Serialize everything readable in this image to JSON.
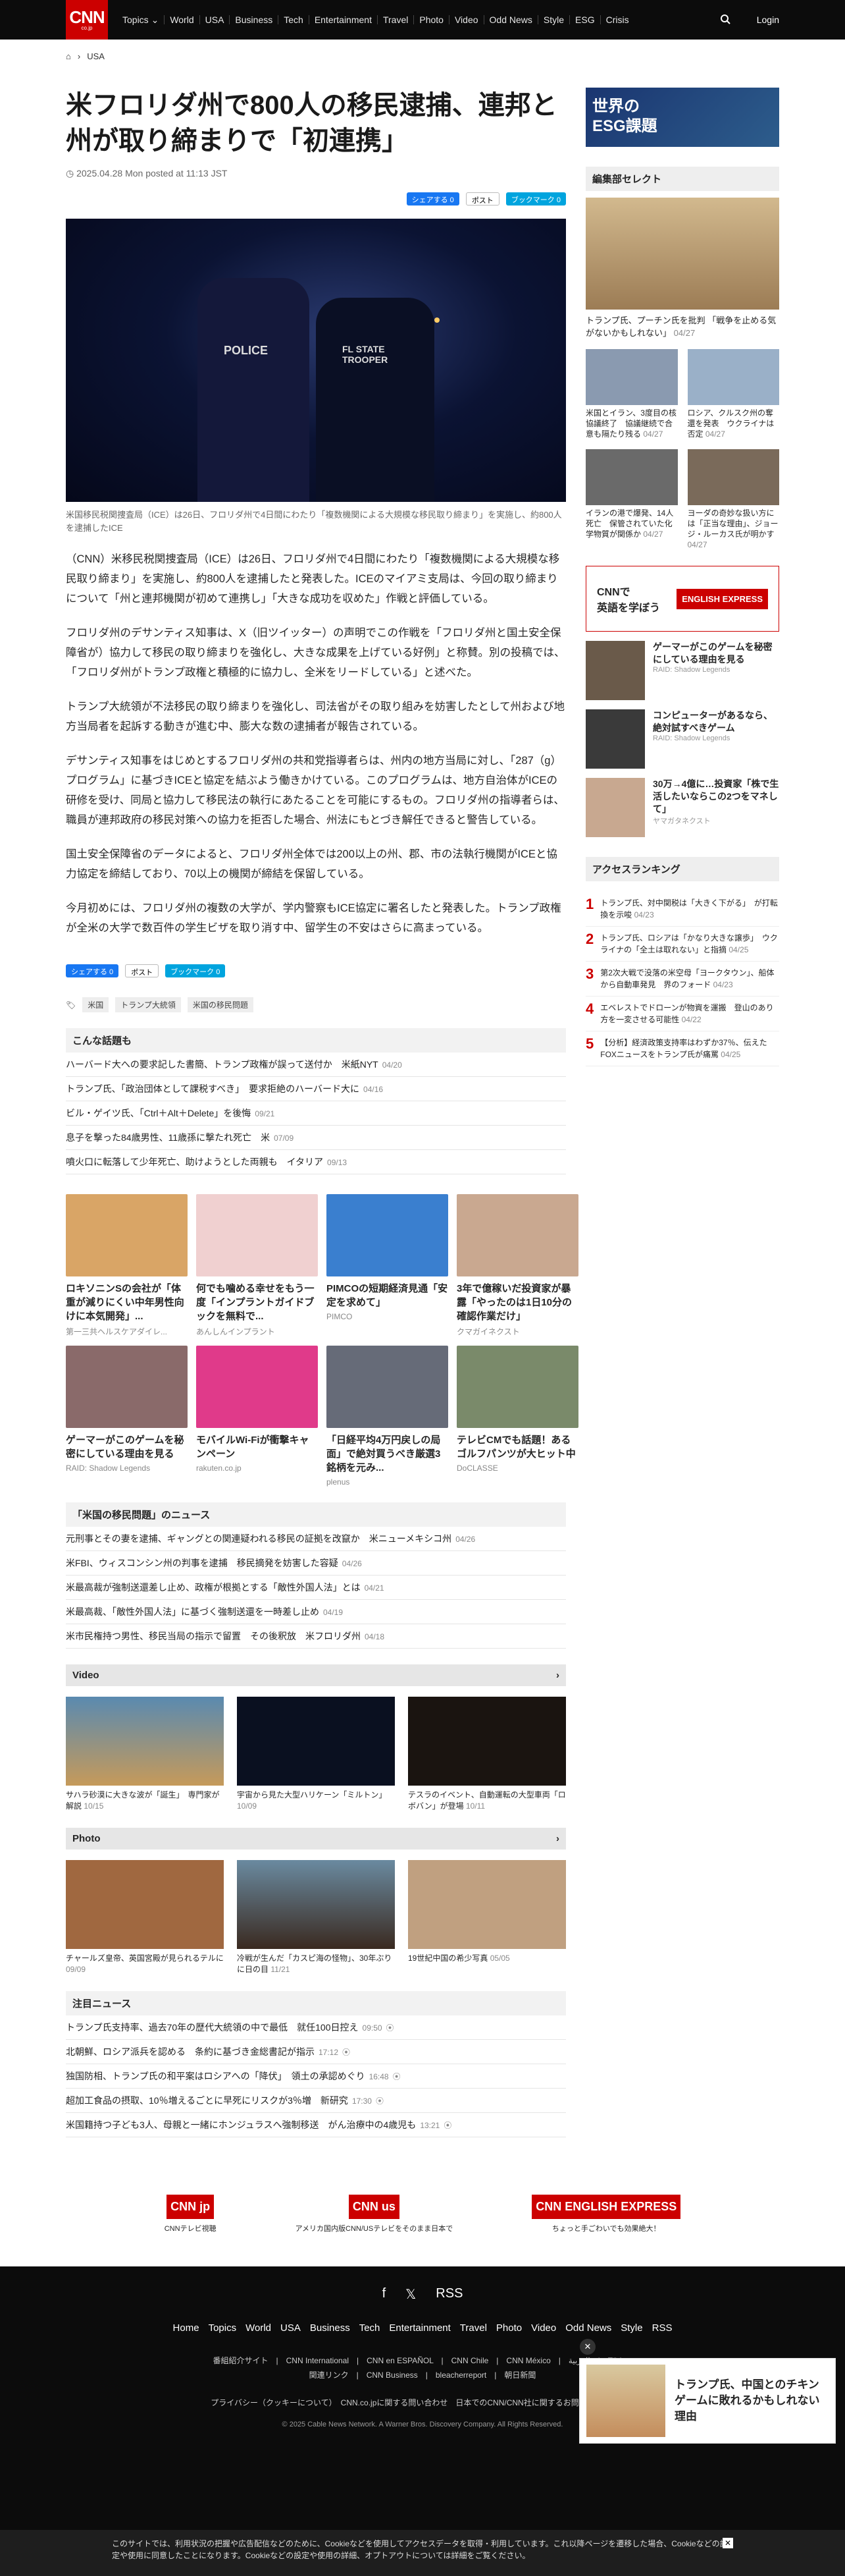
{
  "nav": {
    "logo": "CNN",
    "logo_sub": "co.jp",
    "items": [
      "Topics ⌄",
      "World",
      "USA",
      "Business",
      "Tech",
      "Entertainment",
      "Travel",
      "Photo",
      "Video",
      "Odd News",
      "Style",
      "ESG",
      "Crisis"
    ],
    "login": "Login"
  },
  "breadcrumb": {
    "home": "⌂",
    "current": "USA"
  },
  "article": {
    "title": "米フロリダ州で800人の移民逮捕、連邦と州が取り締まりで「初連携」",
    "date": "2025.04.28 Mon posted at 11:13 JST",
    "share": [
      "シェアする 0",
      "ポスト",
      "ブックマーク 0"
    ],
    "caption": "米国移民税関捜査局（ICE）は26日、フロリダ州で4日間にわたり「複数機関による大規模な移民取り締まり」を実施し、約800人を逮捕したICE",
    "paragraphs": [
      "（CNN）米移民税関捜査局（ICE）は26日、フロリダ州で4日間にわたり「複数機関による大規模な移民取り締まり」を実施し、約800人を逮捕したと発表した。ICEのマイアミ支局は、今回の取り締まりについて「州と連邦機関が初めて連携し」「大きな成功を収めた」作戦と評価している。",
      "フロリダ州のデサンティス知事は、X（旧ツイッター）の声明でこの作戦を「フロリダ州と国土安全保障省が）協力して移民の取り締まりを強化し、大きな成果を上げている好例」と称賛。別の投稿では、「フロリダ州がトランプ政権と積極的に協力し、全米をリードしている」と述べた。",
      "トランプ大統領が不法移民の取り締まりを強化し、司法省がその取り組みを妨害したとして州および地方当局者を起訴する動きが進む中、膨大な数の逮捕者が報告されている。",
      "デサンティス知事をはじめとするフロリダ州の共和党指導者らは、州内の地方当局に対し、「287（g）プログラム」に基づきICEと協定を結ぶよう働きかけている。このプログラムは、地方自治体がICEの研修を受け、同局と協力して移民法の執行にあたることを可能にするもの。フロリダ州の指導者らは、職員が連邦政府の移民対策への協力を拒否した場合、州法にもとづき解任できると警告している。",
      "国土安全保障省のデータによると、フロリダ州全体では200以上の州、郡、市の法執行機関がICEと協力協定を締結しており、70以上の機関が締結を保留している。",
      "今月初めには、フロリダ州の複数の大学が、学内警察もICE協定に署名したと発表した。トランプ政権が全米の大学で数百件の学生ビザを取り消す中、留学生の不安はさらに高まっている。"
    ],
    "tags": [
      "米国",
      "トランプ大統領",
      "米国の移民問題"
    ]
  },
  "related": {
    "title": "こんな話題も",
    "items": [
      {
        "t": "ハーバード大への要求記した書簡、トランプ政権が誤って送付か　米紙NYT",
        "d": "04/20"
      },
      {
        "t": "トランプ氏、「政治団体として課税すべき」　要求拒絶のハーバード大に",
        "d": "04/16"
      },
      {
        "t": "ビル・ゲイツ氏、「Ctrl＋Alt＋Delete」を後悔",
        "d": "09/21"
      },
      {
        "t": "息子を撃った84歳男性、11歳孫に撃たれ死亡　米",
        "d": "07/09"
      },
      {
        "t": "噴火口に転落して少年死亡、助けようとした両親も　イタリア",
        "d": "09/13"
      }
    ]
  },
  "ads": [
    {
      "t": "ロキソニンSの会社が「体重が減りにくい中年男性向けに本気開発」...",
      "s": "第一三共ヘルスケアダイレ..."
    },
    {
      "t": "何でも噛める幸せをもう一度「インプラントガイドブックを無料で...",
      "s": "あんしんインプラント"
    },
    {
      "t": "PIMCOの短期経済見通「安定を求めて」",
      "s": "PIMCO"
    },
    {
      "t": "3年で億稼いだ投資家が暴露「やったのは1日10分の確認作業だけ」",
      "s": "クマガイネクスト"
    },
    {
      "t": "ゲーマーがこのゲームを秘密にしている理由を見る",
      "s": "RAID: Shadow Legends"
    },
    {
      "t": "モバイルWi-Fiが衝撃キャンペーン",
      "s": "rakuten.co.jp"
    },
    {
      "t": "「日経平均4万円戻しの局面」で絶対買うべき厳選3銘柄を元み...",
      "s": "plenus"
    },
    {
      "t": "テレビCMでも話題！あるゴルフパンツが大ヒット中",
      "s": "DoCLASSE"
    }
  ],
  "immig": {
    "title": "「米国の移民問題」のニュース",
    "items": [
      {
        "t": "元刑事とその妻を逮捕、ギャングとの関連疑われる移民の証拠を改竄か　米ニューメキシコ州",
        "d": "04/26"
      },
      {
        "t": "米FBI、ウィスコンシン州の判事を逮捕　移民摘発を妨害した容疑",
        "d": "04/26"
      },
      {
        "t": "米最高裁が強制送還差し止め、政権が根拠とする「敵性外国人法」とは",
        "d": "04/21"
      },
      {
        "t": "米最高裁、「敵性外国人法」に基づく強制送還を一時差し止め",
        "d": "04/19"
      },
      {
        "t": "米市民権持つ男性、移民当局の指示で留置　その後釈放　米フロリダ州",
        "d": "04/18"
      }
    ]
  },
  "video": {
    "title": "Video",
    "items": [
      {
        "t": "サハラ砂漠に大きな波が「誕生」　専門家が解説",
        "d": "10/15"
      },
      {
        "t": "宇宙から見た大型ハリケーン「ミルトン」",
        "d": "10/09"
      },
      {
        "t": "テスラのイベント、自動運転の大型車両「ロボバン」が登場",
        "d": "10/11"
      }
    ]
  },
  "photo": {
    "title": "Photo",
    "items": [
      {
        "t": "チャールズ皇帝、英国宮殿が見られるテルに",
        "d": "09/09"
      },
      {
        "t": "冷戦が生んだ「カスピ海の怪物」、30年ぶりに日の目",
        "d": "11/21"
      },
      {
        "t": "19世紀中国の希少写真",
        "d": "05/05"
      }
    ]
  },
  "notice": {
    "title": "注目ニュース",
    "items": [
      {
        "t": "トランプ氏支持率、過去70年の歴代大統領の中で最低　就任100日控え",
        "d": "09:50"
      },
      {
        "t": "北朝鮮、ロシア派兵を認める　条約に基づき金総書記が指示",
        "d": "17:12"
      },
      {
        "t": "独国防相、トランプ氏の和平案はロシアへの「降伏」　領土の承認めぐり",
        "d": "16:48"
      },
      {
        "t": "超加工食品の摂取、10％増えるごとに早死にリスクが3％増　新研究",
        "d": "17:30"
      },
      {
        "t": "米国籍持つ子ども3人、母親と一緒にホンジュラスへ強制移送　がん治療中の4歳児も",
        "d": "13:21"
      }
    ]
  },
  "side": {
    "banner": "世界の\nESG課題",
    "editor": "編集部セレクト",
    "main": {
      "t": "トランプ氏、プーチン氏を批判 「戦争を止める気がないかもしれない」",
      "d": "04/27"
    },
    "small": [
      {
        "t": "米国とイラン、3度目の核協議終了　協議継続で合意も隔たり残る",
        "d": "04/27"
      },
      {
        "t": "ロシア、クルスク州の奪還を発表　ウクライナは否定",
        "d": "04/27"
      },
      {
        "t": "イランの港で爆発、14人死亡　保管されていた化学物質が関係か",
        "d": "04/27"
      },
      {
        "t": "ヨーダの奇妙な扱い方には「正当な理由」、ジョージ・ルーカス氏が明かす",
        "d": "04/27"
      }
    ],
    "english": {
      "a": "CNNで\n英語を学ぼう",
      "b": "ENGLISH EXPRESS"
    },
    "ads": [
      {
        "t": "ゲーマーがこのゲームを秘密にしている理由を見る",
        "s": "RAID: Shadow Legends"
      },
      {
        "t": "コンピューターがあるなら、絶対試すべきゲーム",
        "s": "RAID: Shadow Legends"
      },
      {
        "t": "30万→4億に…投資家「株で生活したいならこの2つをマネして」",
        "s": "ヤマガタネクスト"
      }
    ],
    "rank_title": "アクセスランキング",
    "rank": [
      {
        "t": "トランプ氏、対中関税は「大きく下がる」　が打転換を示唆",
        "d": "04/23"
      },
      {
        "t": "トランプ氏、ロシアは「かなり大きな譲歩」　ウクライナの「全土は取れない」と指摘",
        "d": "04/25"
      },
      {
        "t": "第2次大戦で没落の米空母「ヨークタウン」、船体から自動車発見　界のフォード",
        "d": "04/23"
      },
      {
        "t": "エベレストでドローンが物資を運搬　登山のあり方を一変させる可能性",
        "d": "04/22"
      },
      {
        "t": "【分析】経済政策支持率はわずか37％、伝えたFOXニュースをトランプ氏が痛罵",
        "d": "04/25"
      }
    ]
  },
  "footer_logos": [
    {
      "c": "CNN jp",
      "t": "CNNテレビ視聴"
    },
    {
      "c": "CNN us",
      "t": "アメリカ国内版CNN/USテレビをそのまま日本で"
    },
    {
      "c": "CNN ENGLISH EXPRESS",
      "t": "ちょっと手ごわいでも効果絶大！"
    }
  ],
  "footer": {
    "icons": [
      "f",
      "𝕏",
      "RSS"
    ],
    "nav": [
      "Home",
      "Topics",
      "World",
      "USA",
      "Business",
      "Tech",
      "Entertainment",
      "Travel",
      "Photo",
      "Video",
      "Odd News",
      "Style",
      "RSS"
    ],
    "sub1": "番組紹介サイト　|　CNN International　|　CNN en ESPAÑOL　|　CNN Chile　|　CNN México　|　العربية　|　Türkçe",
    "sub2": "関連リンク　|　CNN Business　|　bleacherreport　|　朝日新聞",
    "sub3": "プライバシー（クッキーについて）　CNN.co.jpに関する問い合わせ　日本でのCNN/CNN社に関するお問い合わせ　広告",
    "copy": "© 2025 Cable News Network. A Warner Bros. Discovery Company. All Rights Reserved."
  },
  "popup": {
    "t": "トランプ氏、中国とのチキンゲームに敗れるかもしれない理由"
  },
  "cookie": {
    "text": "このサイトでは、利用状況の把握や広告配信などのために、Cookieなどを使用してアクセスデータを取得・利用しています。これ以降ページを遷移した場合、Cookieなどの設定や使用に同意したことになります。Cookieなどの設定や使用の詳細、オプトアウトについては詳細をご覧ください。"
  }
}
